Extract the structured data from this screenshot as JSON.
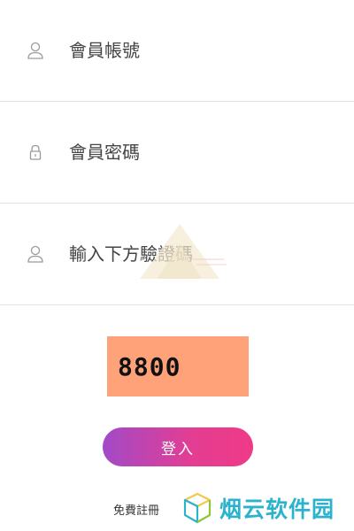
{
  "form": {
    "account": {
      "icon": "user-icon",
      "placeholder": "會員帳號",
      "value": ""
    },
    "password": {
      "icon": "lock-icon",
      "placeholder": "會員密碼",
      "value": ""
    },
    "captcha_input": {
      "icon": "user-icon",
      "placeholder": "輸入下方驗證碼",
      "value": ""
    }
  },
  "captcha": {
    "code": "8800",
    "background": "#ffa27a"
  },
  "login_button": {
    "label": "登入",
    "gradient_start": "#a24ac8",
    "gradient_end": "#ef3a86"
  },
  "register_link": {
    "label": "免費註冊"
  },
  "site_logo": {
    "text": "烟云软件园",
    "color": "#2bb3ce"
  }
}
